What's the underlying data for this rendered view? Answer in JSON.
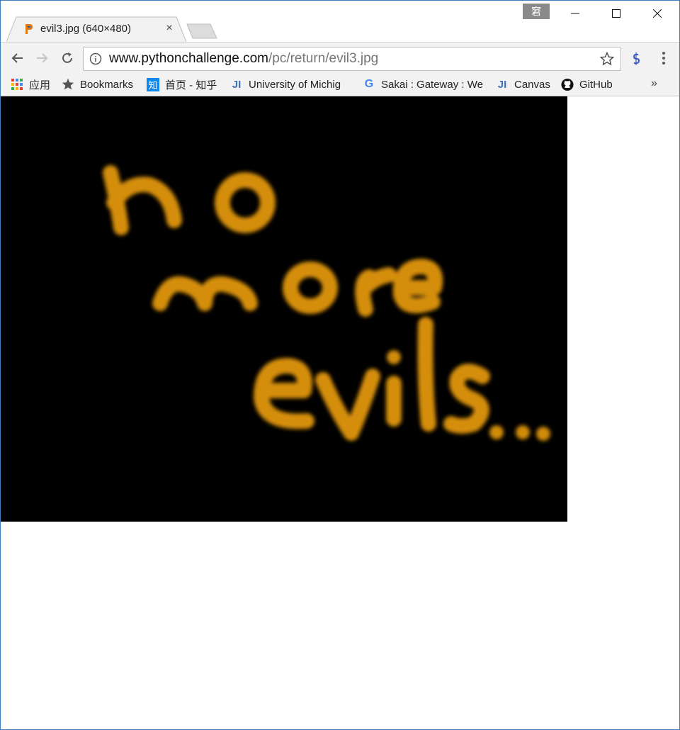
{
  "tab": {
    "title": "evil3.jpg (640×480)",
    "close_glyph": "×",
    "favicon": "python-challenge-favicon"
  },
  "profile": {
    "label": "窘"
  },
  "address_bar": {
    "host": "www.pythonchallenge.com",
    "path": "/pc/return/evil3.jpg"
  },
  "bookmarks": [
    {
      "label": "应用",
      "icon": "apps-grid-icon"
    },
    {
      "label": "Bookmarks",
      "icon": "star-icon"
    },
    {
      "label": "首页 - 知乎",
      "icon": "zhihu-icon",
      "icon_text": "知"
    },
    {
      "label": "University of Michig",
      "icon": "ji-icon",
      "icon_text": "JI"
    },
    {
      "label": "Sakai : Gateway : We",
      "icon": "google-icon",
      "icon_text": "G"
    },
    {
      "label": "Canvas",
      "icon": "ji-icon",
      "icon_text": "JI"
    },
    {
      "label": "GitHub",
      "icon": "github-icon"
    }
  ],
  "overflow_glyph": "»",
  "image": {
    "lines": [
      "no",
      "more",
      "evils..."
    ],
    "text_color": "#e89b0f",
    "background": "#000000"
  },
  "colors": {
    "window_border": "#3b7fc4",
    "toolbar": "#f2f2f2"
  }
}
